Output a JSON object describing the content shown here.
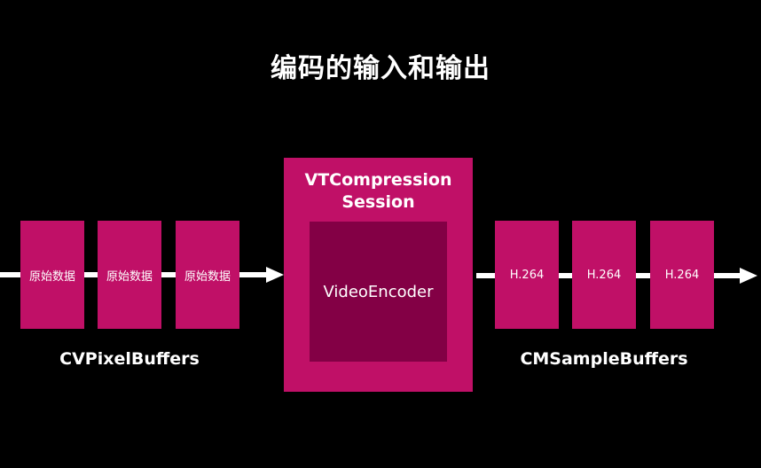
{
  "title": "编码的输入和输出",
  "input": {
    "blocks": [
      "原始数据",
      "原始数据",
      "原始数据"
    ],
    "label": "CVPixelBuffers"
  },
  "session": {
    "title_line1": "VTCompression",
    "title_line2": "Session",
    "encoder_label": "VideoEncoder"
  },
  "output": {
    "blocks": [
      "H.264",
      "H.264",
      "H.264"
    ],
    "label": "CMSampleBuffers"
  },
  "colors": {
    "background": "#000000",
    "block": "#c01067",
    "encoder": "#830045",
    "arrow": "#ffffff",
    "text": "#ffffff"
  }
}
